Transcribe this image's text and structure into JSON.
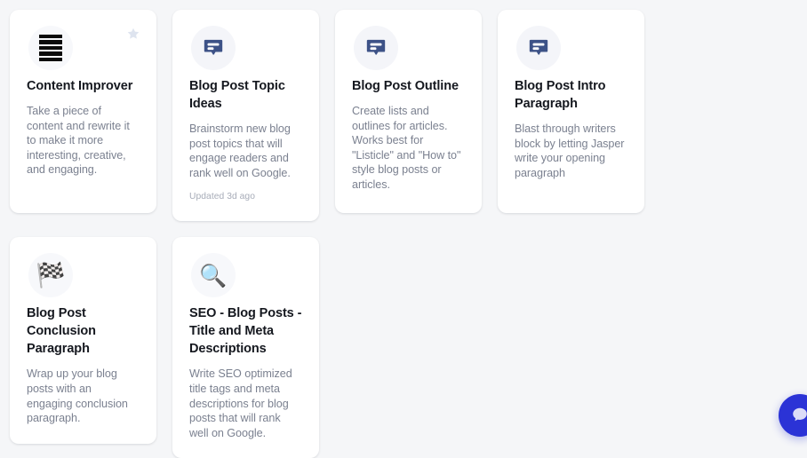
{
  "theme": {
    "page_background": "#f5f6f8",
    "card_background": "#ffffff",
    "icon_circle_background": "#f4f5f9",
    "title_color": "#15181f",
    "description_color": "#7b8190",
    "meta_color": "#a7acb8",
    "chat_icon_color": "#3d5287",
    "star_color": "#dde3ef",
    "accent_button_color": "#2b33d6"
  },
  "cards": [
    {
      "id": "content-improver",
      "title": "Content Improver",
      "description": "Take a piece of content and rewrite it to make it more interesting, creative, and engaging.",
      "icon": "black-bars-icon",
      "icon_glyph": "▤",
      "meta": "",
      "favorite_icon": "star-icon",
      "has_favorite": true
    },
    {
      "id": "blog-post-topic-ideas",
      "title": "Blog Post Topic Ideas",
      "description": "Brainstorm new blog post topics that will engage readers and rank well on Google.",
      "icon": "speech-balloon-icon",
      "icon_glyph": "💬",
      "meta": "Updated 3d ago",
      "favorite_icon": "star-icon",
      "has_favorite": false
    },
    {
      "id": "blog-post-outline",
      "title": "Blog Post Outline",
      "description": "Create lists and outlines for articles. Works best for \"Listicle\" and \"How to\" style blog posts or articles.",
      "icon": "speech-balloon-icon",
      "icon_glyph": "💬",
      "meta": "",
      "favorite_icon": "star-icon",
      "has_favorite": false
    },
    {
      "id": "blog-post-intro-paragraph",
      "title": "Blog Post Intro Paragraph",
      "description": "Blast through writers block by letting Jasper write your opening paragraph",
      "icon": "speech-balloon-icon",
      "icon_glyph": "💬",
      "meta": "",
      "favorite_icon": "star-icon",
      "has_favorite": false
    },
    {
      "id": "blog-post-conclusion-paragraph",
      "title": "Blog Post Conclusion Paragraph",
      "description": "Wrap up your blog posts with an engaging conclusion paragraph.",
      "icon": "chequered-flag-icon",
      "icon_glyph": "🏁",
      "meta": "",
      "favorite_icon": "star-icon",
      "has_favorite": false
    },
    {
      "id": "seo-blog-posts-title-and-meta-descriptions",
      "title": "SEO - Blog Posts - Title and Meta Descriptions",
      "description": "Write SEO optimized title tags and meta descriptions for blog posts that will rank well on Google.",
      "icon": "magnifying-glass-icon",
      "icon_glyph": "🔍",
      "meta": "",
      "favorite_icon": "star-icon",
      "has_favorite": false
    }
  ],
  "floating_action_button": {
    "name": "help-chat-button",
    "icon": "chat-bubble-icon",
    "label": "?"
  }
}
